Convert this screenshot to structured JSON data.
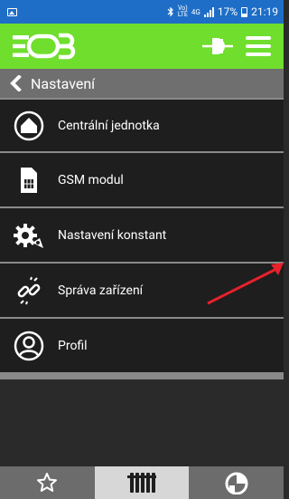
{
  "status_bar": {
    "network_type": "4G",
    "battery": "17%",
    "time": "21:19",
    "bluetooth_icon": "bluetooth-icon",
    "image_icon": "image-notification-icon"
  },
  "app_bar": {
    "logo_text": "EOB",
    "plug_icon": "power-plug-icon",
    "menu_icon": "hamburger-menu-icon"
  },
  "header": {
    "title": "Nastavení",
    "back_icon": "chevron-left-icon"
  },
  "menu": {
    "items": [
      {
        "label": "Centrální jednotka",
        "icon": "home-circle-icon"
      },
      {
        "label": "GSM modul",
        "icon": "sim-card-icon"
      },
      {
        "label": "Nastavení konstant",
        "icon": "gears-icon"
      },
      {
        "label": "Správa zařízení",
        "icon": "unlink-icon"
      },
      {
        "label": "Profil",
        "icon": "user-circle-icon"
      }
    ]
  },
  "bottom_nav": {
    "tabs": [
      {
        "icon": "star-icon",
        "active": false
      },
      {
        "icon": "radiator-icon",
        "active": true
      },
      {
        "icon": "gauge-icon",
        "active": false
      }
    ]
  },
  "colors": {
    "status_bar": "#1e6ec7",
    "app_bar": "#6fde2c",
    "header": "#6f6f6f",
    "list_bg": "#1e1e1e",
    "divider": "#8a8a8a",
    "bottom_bar": "#6c6c6c",
    "active_tab": "#d7d7d7",
    "annotation_arrow": "#e8212a"
  }
}
